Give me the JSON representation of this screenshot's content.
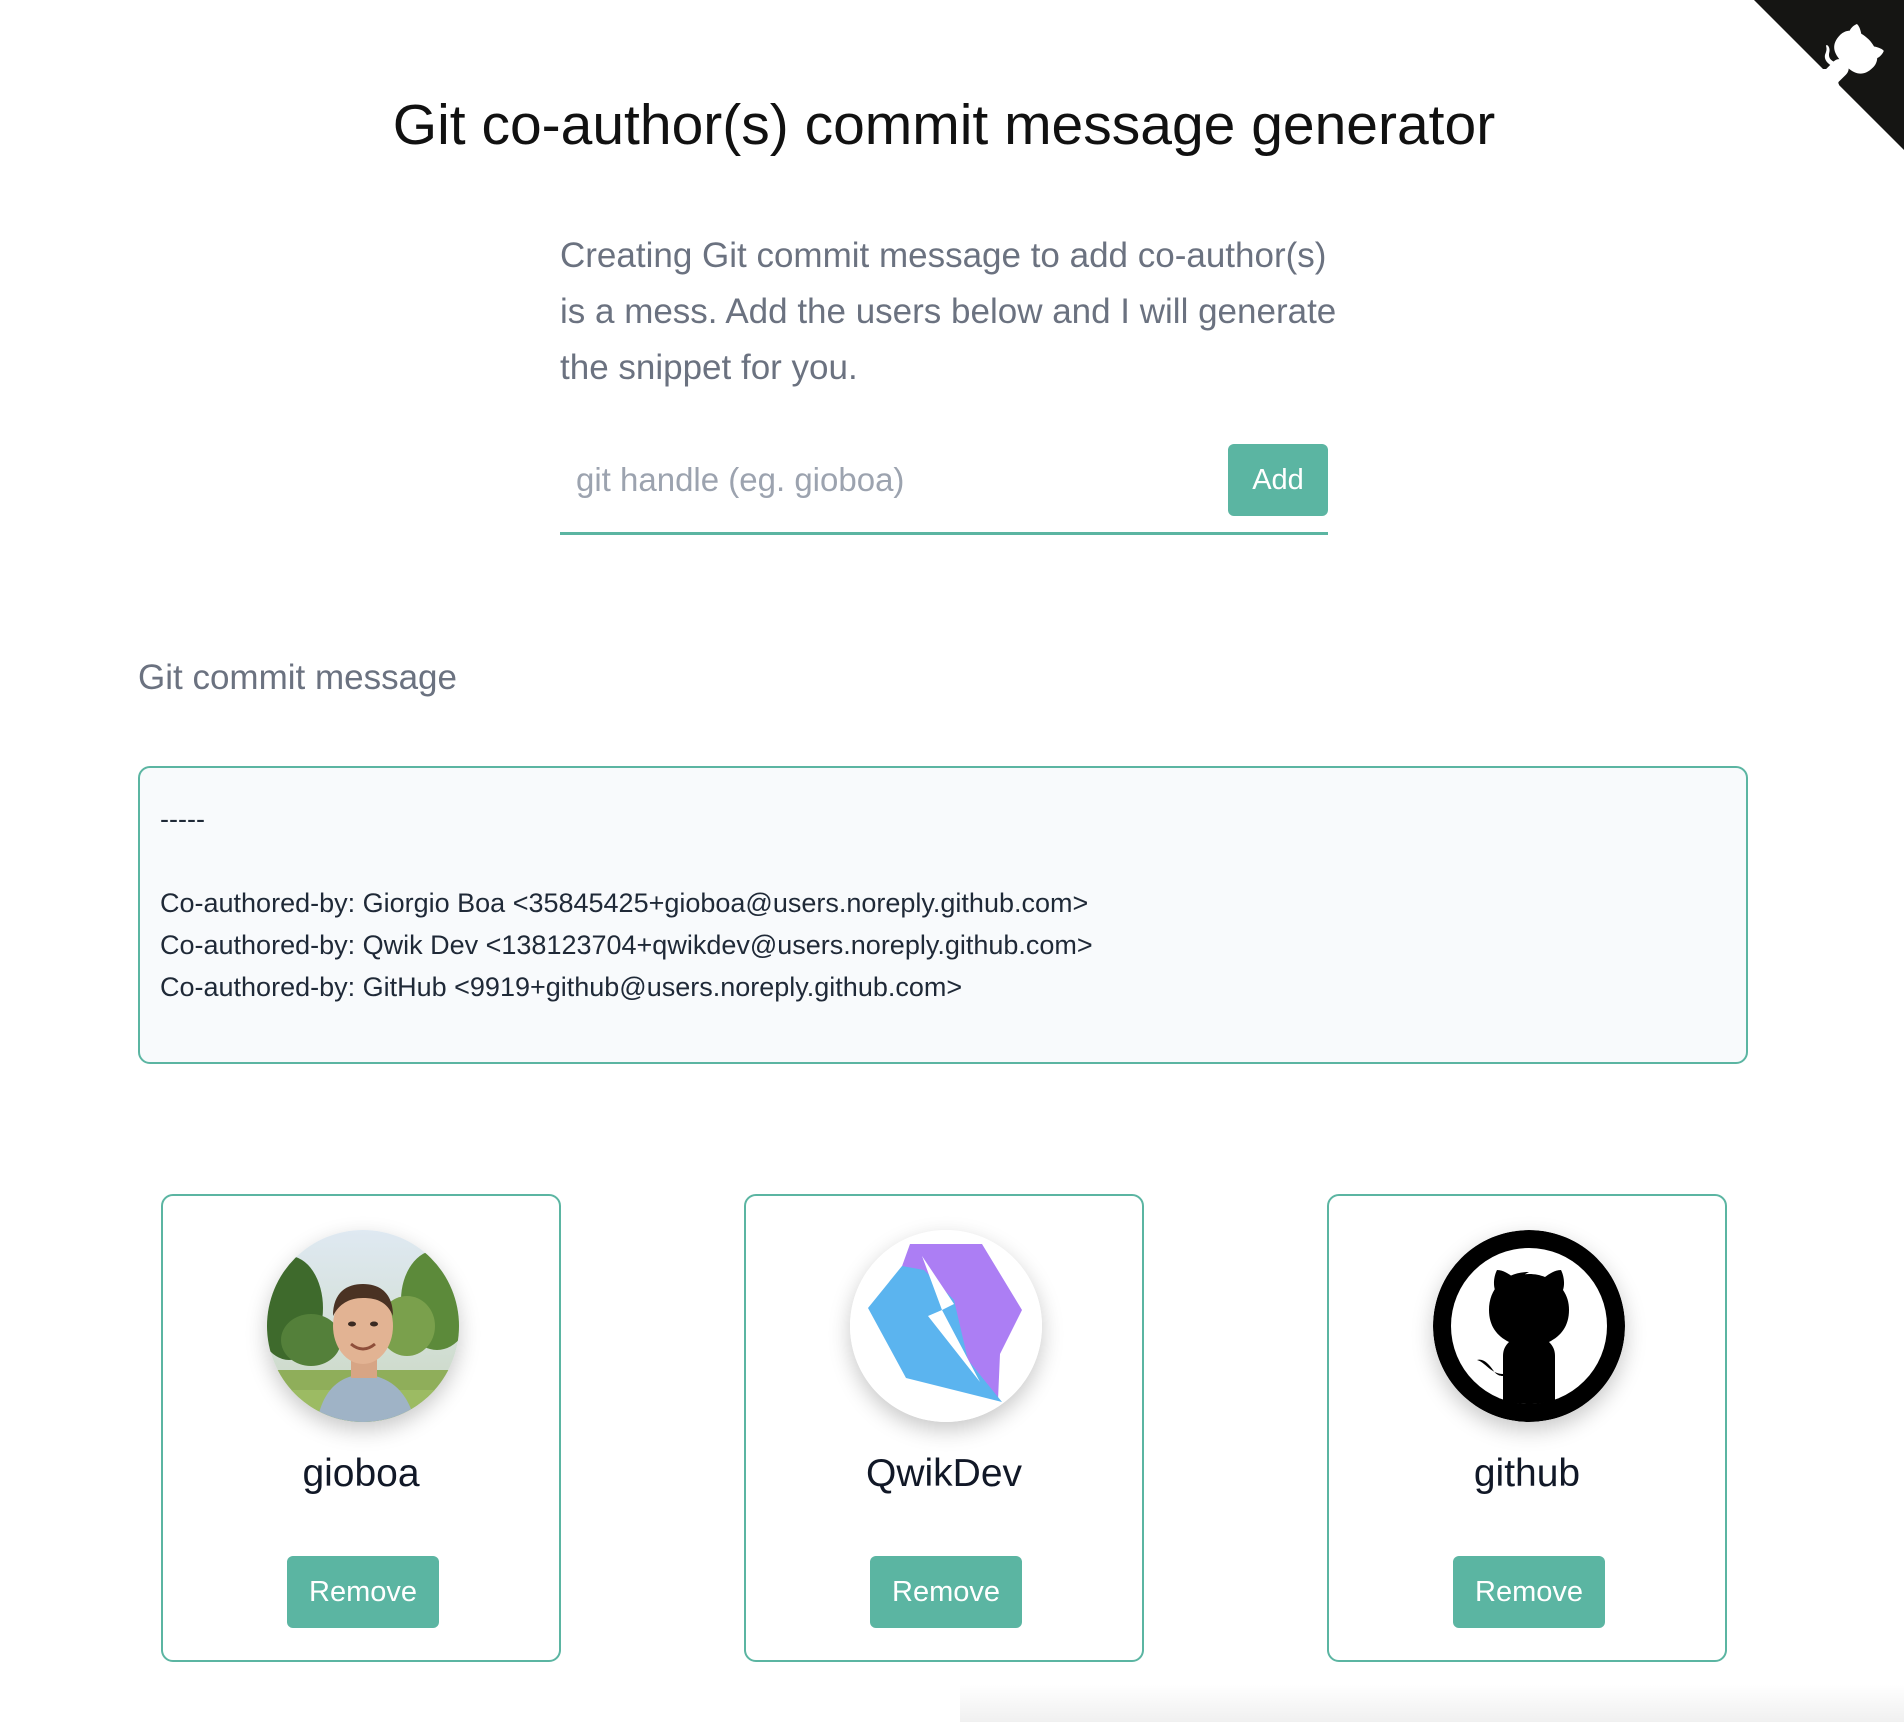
{
  "header": {
    "title": "Git co-author(s) commit message generator",
    "github_corner_icon": "github-octocat-icon"
  },
  "intro": {
    "text": "Creating Git commit message to add co-author(s) is a mess. Add the users below and I will generate the snippet for you."
  },
  "add_form": {
    "placeholder": "git handle (eg. gioboa)",
    "value": "",
    "add_label": "Add"
  },
  "commit": {
    "label": "Git commit message",
    "separator": "-----",
    "lines": [
      "Co-authored-by: Giorgio Boa <35845425+gioboa@users.noreply.github.com>",
      "Co-authored-by: Qwik Dev <138123704+qwikdev@users.noreply.github.com>",
      "Co-authored-by: GitHub <9919+github@users.noreply.github.com>"
    ]
  },
  "users": [
    {
      "handle": "gioboa",
      "avatar": "person-photo",
      "remove_label": "Remove"
    },
    {
      "handle": "QwikDev",
      "avatar": "qwik-logo-icon",
      "remove_label": "Remove"
    },
    {
      "handle": "github",
      "avatar": "github-octocat-icon",
      "remove_label": "Remove"
    }
  ],
  "colors": {
    "accent": "#5bb5a2",
    "muted_text": "#6b7280",
    "box_background": "#f8fafc"
  }
}
